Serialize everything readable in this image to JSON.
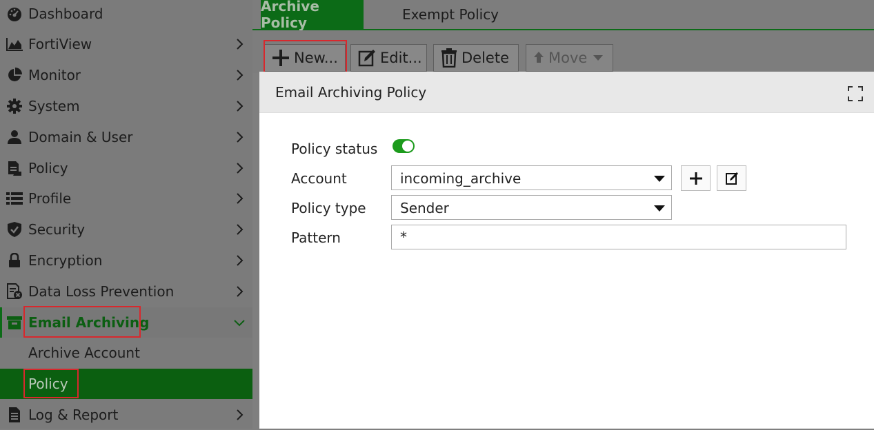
{
  "sidebar": {
    "items": [
      {
        "label": "Dashboard",
        "icon": "dashboard-gauge-icon"
      },
      {
        "label": "FortiView",
        "icon": "area-chart-icon"
      },
      {
        "label": "Monitor",
        "icon": "pie-chart-icon"
      },
      {
        "label": "System",
        "icon": "gear-icon"
      },
      {
        "label": "Domain & User",
        "icon": "user-icon"
      },
      {
        "label": "Policy",
        "icon": "policy-document-icon"
      },
      {
        "label": "Profile",
        "icon": "list-icon"
      },
      {
        "label": "Security",
        "icon": "shield-check-icon"
      },
      {
        "label": "Encryption",
        "icon": "lock-icon"
      },
      {
        "label": "Data Loss Prevention",
        "icon": "document-x-icon"
      },
      {
        "label": "Email Archiving",
        "icon": "archive-box-icon"
      },
      {
        "label": "Log & Report",
        "icon": "report-document-icon"
      }
    ],
    "sub_items": [
      {
        "label": "Archive Account"
      },
      {
        "label": "Policy"
      }
    ]
  },
  "tabs": [
    {
      "label": "Archive Policy",
      "active": true
    },
    {
      "label": "Exempt Policy",
      "active": false
    }
  ],
  "toolbar": {
    "new_label": "New...",
    "edit_label": "Edit...",
    "delete_label": "Delete",
    "move_label": "Move"
  },
  "modal": {
    "title": "Email Archiving Policy",
    "fields": {
      "status_label": "Policy status",
      "status_enabled": true,
      "account_label": "Account",
      "account_value": "incoming_archive",
      "type_label": "Policy type",
      "type_value": "Sender",
      "pattern_label": "Pattern",
      "pattern_value": "*"
    }
  },
  "colors": {
    "accent_green": "#0c6b17",
    "toggle_on": "#1c9b1c",
    "highlight_red": "#d8282d"
  }
}
